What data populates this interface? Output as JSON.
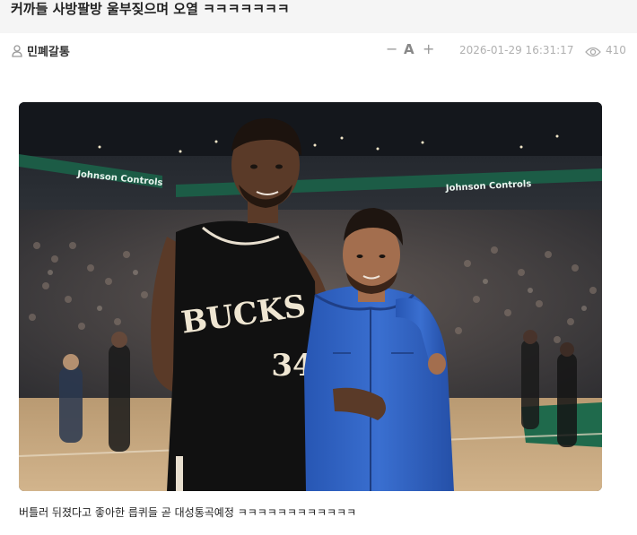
{
  "post": {
    "title": "커까들 사방팔방 울부짖으며 오열 ㅋㅋㅋㅋㅋㅋㅋ",
    "author": "민폐갈통",
    "font_controls": {
      "decrease": "−",
      "label": "A",
      "increase": "+"
    },
    "date": "2026-01-29 16:31:17",
    "views": "410",
    "caption": "버틀러 뒤졌다고 좋아한 릅퀴들 곧 대성통곡예정 ㅋㅋㅋㅋㅋㅋㅋㅋㅋㅋㅋㅋ"
  },
  "photo": {
    "banner_text": "Johnson Controls",
    "jersey_team": "BUCKS",
    "jersey_number": "34"
  },
  "colors": {
    "title_bg": "#f5f5f5",
    "meta_text": "#b0b0b0",
    "jersey": "#111111",
    "jacket": "#2f62c4",
    "court_green": "#1f6a4c"
  },
  "icons": {
    "author": "person-icon",
    "views": "eye-icon"
  }
}
